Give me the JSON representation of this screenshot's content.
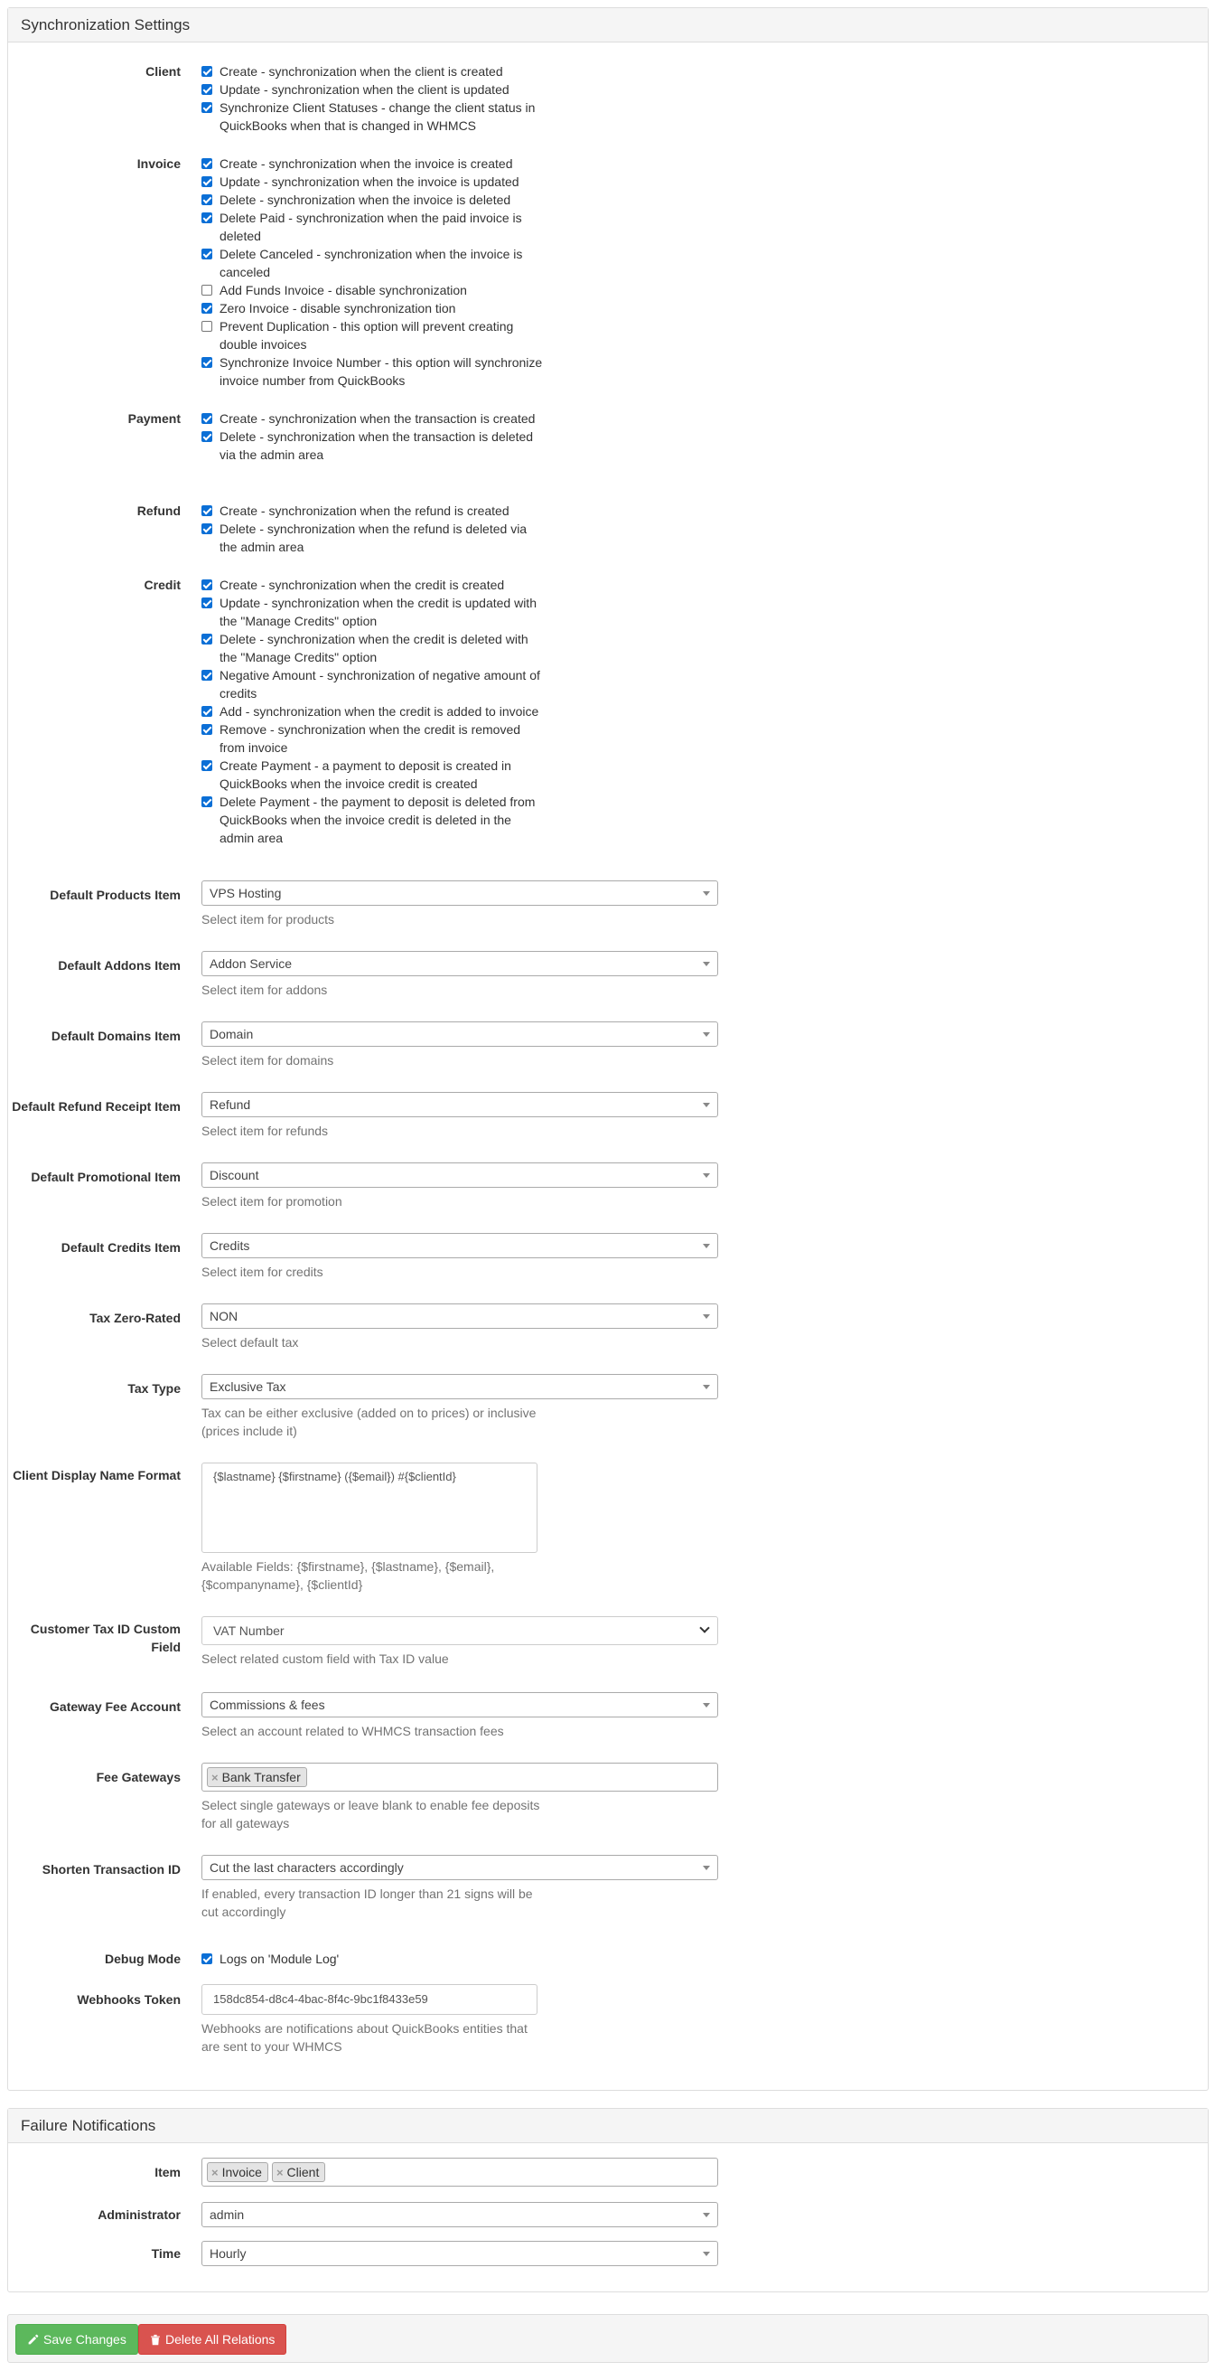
{
  "sync": {
    "heading": "Synchronization Settings",
    "client": {
      "label": "Client",
      "items": [
        {
          "text": "Create - synchronization when the client is created",
          "checked": true
        },
        {
          "text": "Update - synchronization when the client is updated",
          "checked": true
        },
        {
          "text": "Synchronize Client Statuses - change the client status in QuickBooks when that is changed in WHMCS",
          "checked": true
        }
      ]
    },
    "invoice": {
      "label": "Invoice",
      "items": [
        {
          "text": "Create - synchronization when the invoice is created",
          "checked": true
        },
        {
          "text": "Update - synchronization when the invoice is updated",
          "checked": true
        },
        {
          "text": "Delete - synchronization when the invoice is deleted",
          "checked": true
        },
        {
          "text": "Delete Paid - synchronization when the paid invoice is deleted",
          "checked": true
        },
        {
          "text": "Delete Canceled - synchronization when the invoice is canceled",
          "checked": true
        },
        {
          "text": "Add Funds Invoice - disable synchronization",
          "checked": false
        },
        {
          "text": "Zero Invoice - disable synchronization    tion",
          "checked": true
        },
        {
          "text": "Prevent Duplication - this option will prevent creating double invoices",
          "checked": false
        },
        {
          "text": "Synchronize Invoice Number - this option will synchronize invoice number from QuickBooks",
          "checked": true
        }
      ]
    },
    "payment": {
      "label": "Payment",
      "items": [
        {
          "text": "Create - synchronization when the transaction is created",
          "checked": true
        },
        {
          "text": "Delete - synchronization when the transaction is deleted via the admin area",
          "checked": true
        }
      ]
    },
    "refund": {
      "label": "Refund",
      "items": [
        {
          "text": "Create - synchronization when the refund is created",
          "checked": true
        },
        {
          "text": "Delete - synchronization when the refund is deleted via the admin area",
          "checked": true
        }
      ]
    },
    "credit": {
      "label": "Credit",
      "items": [
        {
          "text": "Create - synchronization when the credit is created",
          "checked": true
        },
        {
          "text": "Update - synchronization when the credit is updated with the \"Manage Credits\" option",
          "checked": true
        },
        {
          "text": "Delete - synchronization when the credit is deleted with the \"Manage Credits\" option",
          "checked": true
        },
        {
          "text": "Negative Amount - synchronization of negative amount of credits",
          "checked": true
        },
        {
          "text": "Add - synchronization when the credit is added to invoice",
          "checked": true
        },
        {
          "text": "Remove - synchronization when the credit is removed from invoice",
          "checked": true
        },
        {
          "text": "Create Payment - a payment to deposit is created in QuickBooks when the invoice credit is created",
          "checked": true
        },
        {
          "text": "Delete Payment - the payment to deposit is deleted from QuickBooks when the invoice credit is deleted in the admin area",
          "checked": true
        }
      ]
    },
    "products": {
      "label": "Default Products Item",
      "value": "VPS Hosting",
      "help": "Select item for products"
    },
    "addons": {
      "label": "Default Addons Item",
      "value": "Addon Service",
      "help": "Select item for addons"
    },
    "domains": {
      "label": "Default Domains Item",
      "value": "Domain",
      "help": "Select item for domains"
    },
    "refund_receipt": {
      "label": "Default Refund Receipt Item",
      "value": "Refund",
      "help": "Select item for refunds"
    },
    "promotional": {
      "label": "Default Promotional Item",
      "value": "Discount",
      "help": "Select item for promotion"
    },
    "credits_item": {
      "label": "Default Credits Item",
      "value": "Credits",
      "help": "Select item for credits"
    },
    "tax_zero": {
      "label": "Tax Zero-Rated",
      "value": "NON",
      "help": "Select default tax"
    },
    "tax_type": {
      "label": "Tax Type",
      "value": "Exclusive Tax",
      "help": "Tax can be either exclusive (added on to prices) or inclusive (prices include it)"
    },
    "display_name": {
      "label": "Client Display Name Format",
      "value": "{$lastname} {$firstname} ({$email}) #{$clientId}",
      "help": "Available Fields: {$firstname}, {$lastname}, {$email}, {$companyname}, {$clientId}"
    },
    "tax_id": {
      "label": "Customer Tax ID Custom Field",
      "value": "VAT Number",
      "help": "Select related custom field with Tax ID value"
    },
    "gateway_fee": {
      "label": "Gateway Fee Account",
      "value": "Commissions & fees",
      "help": "Select an account related to WHMCS transaction fees"
    },
    "fee_gateways": {
      "label": "Fee Gateways",
      "tags": [
        "Bank Transfer"
      ],
      "help": "Select single gateways or leave blank to enable fee deposits for all gateways"
    },
    "shorten": {
      "label": "Shorten Transaction ID",
      "value": "Cut the last characters accordingly",
      "help": "If enabled, every transaction ID longer than 21 signs will be cut accordingly"
    },
    "debug": {
      "label": "Debug Mode",
      "text": "Logs on 'Module Log'",
      "checked": true
    },
    "webhooks": {
      "label": "Webhooks Token",
      "value": "158dc854-d8c4-4bac-8f4c-9bc1f8433e59",
      "help": "Webhooks are notifications about QuickBooks entities that are sent to your WHMCS"
    }
  },
  "failure": {
    "heading": "Failure Notifications",
    "item": {
      "label": "Item",
      "tags": [
        "Invoice",
        "Client"
      ]
    },
    "administrator": {
      "label": "Administrator",
      "value": "admin"
    },
    "time": {
      "label": "Time",
      "value": "Hourly"
    }
  },
  "footer": {
    "save_label": "Save Changes",
    "delete_label": "Delete All Relations"
  },
  "colors": {
    "checkbox": "#0b6fd6",
    "success": "#5cb85c",
    "danger": "#d9534f"
  },
  "icons": {
    "save": "pencil-icon",
    "delete": "trash-icon",
    "remove_tag": "x-icon"
  }
}
